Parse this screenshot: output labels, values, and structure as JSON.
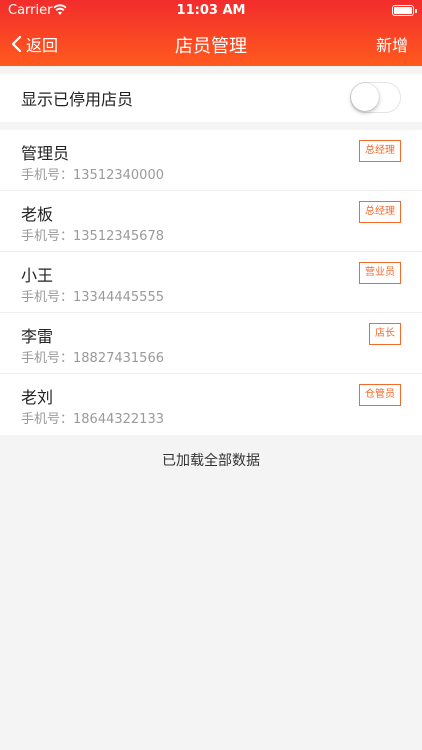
{
  "status_bar": {
    "carrier": "Carrier",
    "time": "11:03 AM"
  },
  "nav": {
    "back_label": "返回",
    "title": "店员管理",
    "action_label": "新增"
  },
  "toggle": {
    "label": "显示已停用店员",
    "on": false
  },
  "staff": [
    {
      "name": "管理员",
      "phone": "手机号：13512340000",
      "role": "总经理"
    },
    {
      "name": "老板",
      "phone": "手机号：13512345678",
      "role": "总经理"
    },
    {
      "name": "小王",
      "phone": "手机号：13344445555",
      "role": "营业员"
    },
    {
      "name": "李雷",
      "phone": "手机号：18827431566",
      "role": "店长"
    },
    {
      "name": "老刘",
      "phone": "手机号：18644322133",
      "role": "仓管员"
    }
  ],
  "footer_text": "已加载全部数据",
  "colors": {
    "header_start": "#f22c2c",
    "header_end": "#ff5a1e",
    "badge": "#f26a2c"
  }
}
